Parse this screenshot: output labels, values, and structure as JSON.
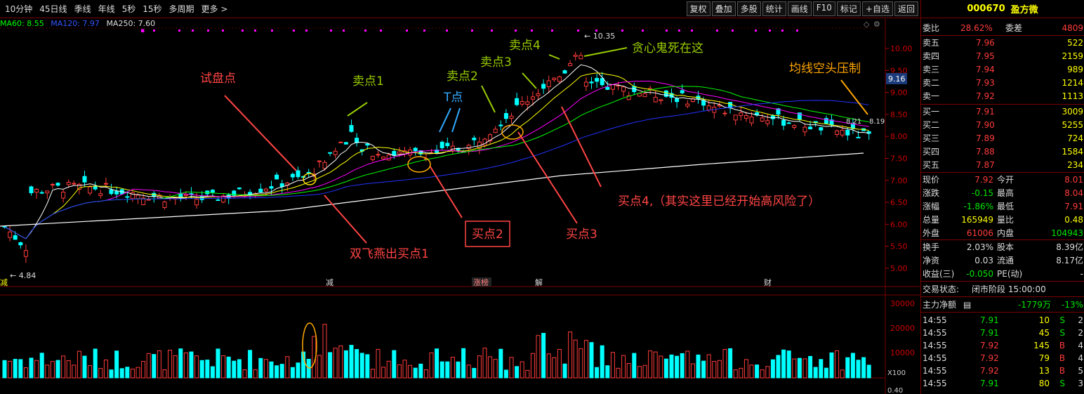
{
  "toolbar": {
    "periods": [
      "10分钟",
      "45日线",
      "季线",
      "年线",
      "5秒",
      "15秒",
      "多周期",
      "更多 >"
    ],
    "tools": [
      "复权",
      "叠加",
      "多股",
      "统计",
      "画线",
      "F10",
      "标记",
      "+自选",
      "返回"
    ]
  },
  "ma_legend": {
    "ma60": "MA60: 8.55",
    "ma120": "MA120: 7.97",
    "ma250": "MA250: 7.60"
  },
  "colors": {
    "up": "#ff3b3b",
    "down": "#00ffff",
    "ma5": "#ffffff",
    "ma10": "#ffff00",
    "ma20": "#ff00ff",
    "ma30": "#00ff00",
    "ma60": "#0000ff",
    "ma250": "#ffffff",
    "annotation_red": "#ff4444",
    "annotation_green": "#99cc00",
    "annotation_blue": "#33aaff",
    "annotation_orange": "#ffa500"
  },
  "chart": {
    "price_axis": [
      "10.00",
      "9.50",
      "9.00",
      "8.50",
      "8.00",
      "7.50",
      "7.00",
      "6.50",
      "6.00",
      "5.50",
      "5.00"
    ],
    "volume_axis": [
      "30000",
      "20000",
      "10000"
    ],
    "volume_unit": "X100",
    "vol_bottom_label": "0.40",
    "high_label": "10.35",
    "low_label": "4.84",
    "current_tag": "9.16",
    "ma_end_labels": [
      "8.21",
      "8.19"
    ],
    "event_tags": [
      "减",
      "涨榜",
      "解",
      "财"
    ],
    "first_tag": "减",
    "annotations": {
      "trial": "试盘点",
      "sell1": "卖点1",
      "sell2": "卖点2",
      "sell3": "卖点3",
      "sell4": "卖点4",
      "tpoint": "T点",
      "greed": "贪心鬼死在这",
      "ma_suppress": "均线空头压制",
      "buy1": "双飞燕出买点1",
      "buy2": "买点2",
      "buy3": "买点3",
      "buy4": "买点4,（其实这里已经开始高风险了）"
    }
  },
  "panel": {
    "code": "000670",
    "name": "盈方微",
    "webi_label": "委比",
    "webi_value": "28.62%",
    "wecha_label": "委差",
    "wecha_value": "4809",
    "asks": [
      {
        "label": "卖五",
        "price": "7.96",
        "vol": "522"
      },
      {
        "label": "卖四",
        "price": "7.95",
        "vol": "2159"
      },
      {
        "label": "卖三",
        "price": "7.94",
        "vol": "989"
      },
      {
        "label": "卖二",
        "price": "7.93",
        "vol": "1214"
      },
      {
        "label": "卖一",
        "price": "7.92",
        "vol": "1113"
      }
    ],
    "bids": [
      {
        "label": "买一",
        "price": "7.91",
        "vol": "3009"
      },
      {
        "label": "买二",
        "price": "7.90",
        "vol": "5255"
      },
      {
        "label": "买三",
        "price": "7.89",
        "vol": "724"
      },
      {
        "label": "买四",
        "price": "7.88",
        "vol": "1584"
      },
      {
        "label": "买五",
        "price": "7.87",
        "vol": "234"
      }
    ],
    "quote": [
      {
        "l1": "现价",
        "v1": "7.92",
        "l2": "今开",
        "v2": "8.01"
      },
      {
        "l1": "涨跌",
        "v1": "-0.15",
        "l2": "最高",
        "v2": "8.04"
      },
      {
        "l1": "涨幅",
        "v1": "-1.86%",
        "l2": "最低",
        "v2": "7.91"
      },
      {
        "l1": "总量",
        "v1": "165949",
        "l2": "量比",
        "v2": "0.48"
      },
      {
        "l1": "外盘",
        "v1": "61006",
        "l2": "内盘",
        "v2": "104943"
      }
    ],
    "extra": [
      {
        "l1": "换手",
        "v1": "2.03%",
        "l2": "股本",
        "v2": "8.39亿"
      },
      {
        "l1": "净资",
        "v1": "0.03",
        "l2": "流通",
        "v2": "8.17亿"
      },
      {
        "l1": "收益(三)",
        "v1": "-0.050",
        "l2": "PE(动)",
        "v2": "-"
      }
    ],
    "status_label": "交易状态:",
    "status_value": "闭市阶段 15:00:00",
    "flow_label": "主力净额",
    "flow_value": "-1779万",
    "flow_pct": "-13%",
    "ticks": [
      {
        "time": "14:55",
        "price": "7.91",
        "vol": "10",
        "side": "S",
        "n": "2"
      },
      {
        "time": "14:55",
        "price": "7.91",
        "vol": "45",
        "side": "S",
        "n": "2"
      },
      {
        "time": "14:55",
        "price": "7.92",
        "vol": "145",
        "side": "B",
        "n": "4"
      },
      {
        "time": "14:55",
        "price": "7.92",
        "vol": "79",
        "side": "B",
        "n": "4"
      },
      {
        "time": "14:55",
        "price": "7.92",
        "vol": "13",
        "side": "B",
        "n": "5"
      },
      {
        "time": "14:55",
        "price": "7.91",
        "vol": "80",
        "side": "S",
        "n": "3"
      }
    ]
  }
}
